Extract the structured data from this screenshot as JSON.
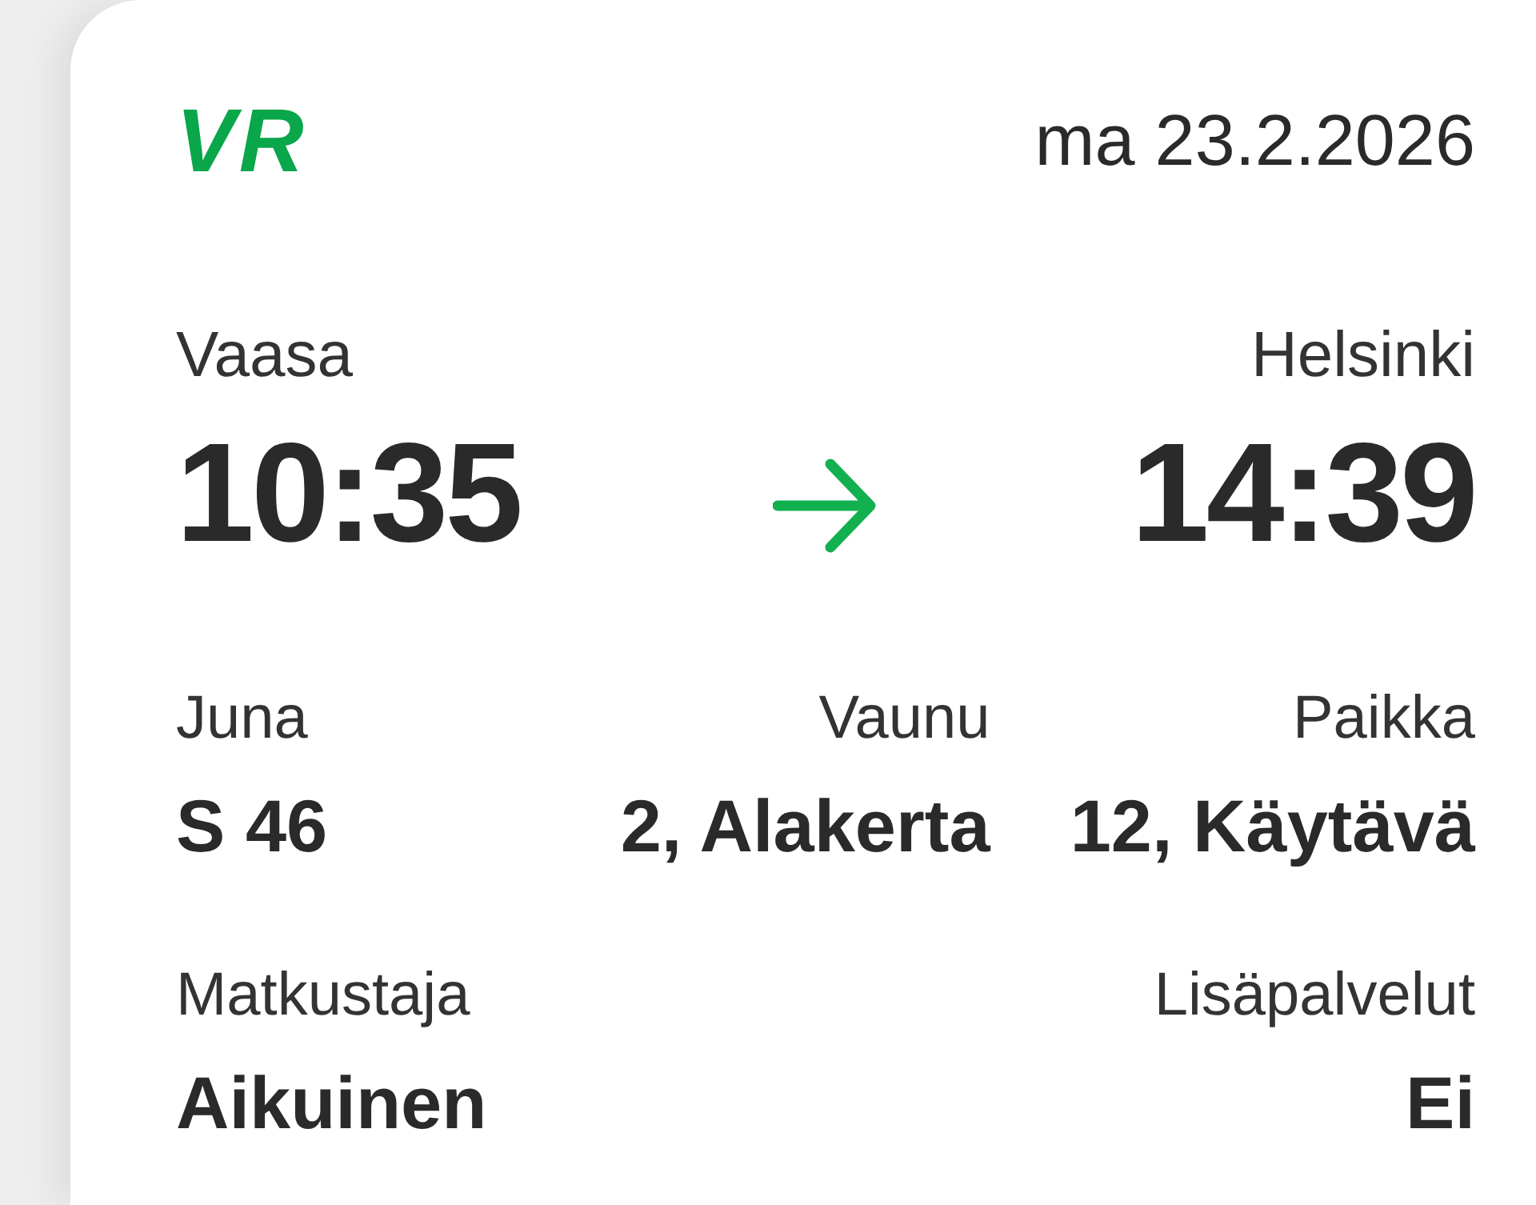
{
  "header": {
    "logo": "VR",
    "date": "ma 23.2.2026"
  },
  "route": {
    "origin": {
      "station": "Vaasa",
      "time": "10:35"
    },
    "destination": {
      "station": "Helsinki",
      "time": "14:39"
    }
  },
  "details": [
    {
      "label": "Juna",
      "value": "S 46"
    },
    {
      "label": "Vaunu",
      "value": "2, Alakerta"
    },
    {
      "label": "Paikka",
      "value": "12, Käytävä"
    }
  ],
  "passenger": [
    {
      "label": "Matkustaja",
      "value": "Aikuinen"
    },
    {
      "label": "Lisäpalvelut",
      "value": "Ei"
    }
  ]
}
